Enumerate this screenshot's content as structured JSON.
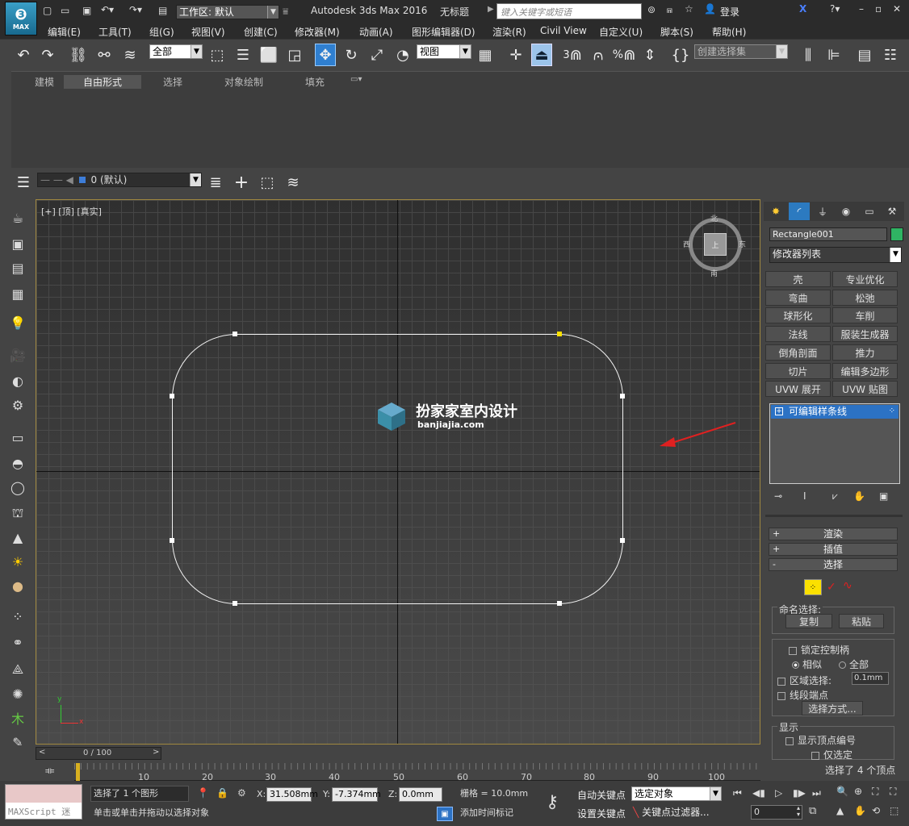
{
  "titlebar": {
    "app_logo": "MAX",
    "workspace_label": "工作区: 默认",
    "app_title": "Autodesk 3ds Max 2016",
    "doc_title": "无标题",
    "search_placeholder": "键入关键字或短语",
    "login": "登录"
  },
  "menu": [
    "编辑(E)",
    "工具(T)",
    "组(G)",
    "视图(V)",
    "创建(C)",
    "修改器(M)",
    "动画(A)",
    "图形编辑器(D)",
    "渲染(R)",
    "Civil View",
    "自定义(U)",
    "脚本(S)",
    "帮助(H)"
  ],
  "toolbar": {
    "filter_value": "全部",
    "refcoord_value": "视图",
    "selset_value": "创建选择集",
    "snap_3": "3",
    "snap_pct": "%"
  },
  "ribbon": {
    "tabs": [
      "建模",
      "自由形式",
      "选择",
      "对象绘制",
      "填充"
    ],
    "active": "自由形式"
  },
  "layer": {
    "current": "0 (默认)"
  },
  "viewport": {
    "label": "[+] [顶] [真实]",
    "watermark_cn": "扮家家室内设计",
    "watermark_url": "banjiajia.com",
    "viewcube": {
      "n": "北",
      "s": "南",
      "e": "东",
      "w": "西",
      "top": "上"
    },
    "axis_x": "x",
    "axis_y": "y"
  },
  "command_panel": {
    "object_name": "Rectangle001",
    "object_color": "#2fb463",
    "modifier_list": "修改器列表",
    "modifier_buttons": [
      "壳",
      "专业优化",
      "弯曲",
      "松弛",
      "球形化",
      "车削",
      "法线",
      "服装生成器",
      "倒角剖面",
      "推力",
      "切片",
      "编辑多边形",
      "UVW 展开",
      "UVW 贴图"
    ],
    "stack_item": "可编辑样条线",
    "rollouts": {
      "render": "渲染",
      "interp": "插值",
      "select": "选择"
    },
    "named_sel": "命名选择:",
    "copy": "复制",
    "paste": "粘贴",
    "lock_handles": "锁定控制柄",
    "similar": "相似",
    "all": "全部",
    "area_sel": "区域选择:",
    "area_val": "0.1mm",
    "seg_end": "线段端点",
    "sel_by": "选择方式...",
    "display": "显示",
    "show_vertex_num": "显示顶点编号",
    "only_selected": "仅选定",
    "selected_info": "选择了 4 个顶点"
  },
  "timeline": {
    "frame": "0 / 100",
    "ticks": [
      "10",
      "20",
      "30",
      "40",
      "50",
      "60",
      "70",
      "80",
      "90",
      "100"
    ]
  },
  "status": {
    "maxscript": "MAXScript 迷",
    "sel_text": "选择了 1 个图形",
    "prompt": "单击或单击并拖动以选择对象",
    "x_label": "X:",
    "x_val": "31.508mm",
    "y_label": "Y:",
    "y_val": "-7.374mm",
    "z_label": "Z:",
    "z_val": "0.0mm",
    "grid": "栅格 = 10.0mm",
    "add_time_tag": "添加时间标记",
    "auto_key": "自动关键点",
    "set_key": "设置关键点",
    "key_target": "选定对象",
    "key_filters": "关键点过滤器...",
    "frame_field": "0"
  }
}
